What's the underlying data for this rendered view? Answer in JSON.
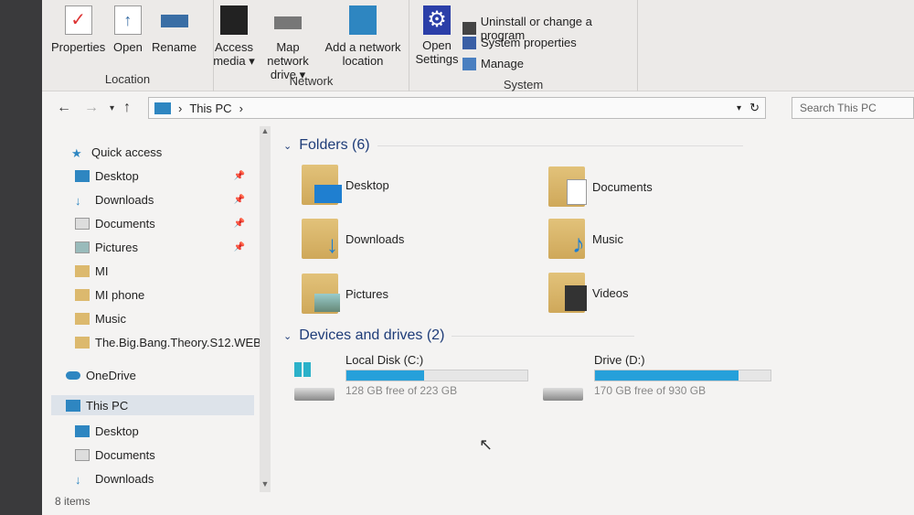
{
  "ribbon": {
    "location": {
      "label": "Location",
      "properties": "Properties",
      "open": "Open",
      "rename": "Rename"
    },
    "network": {
      "label": "Network",
      "access_media": "Access media ▾",
      "map_drive": "Map network drive ▾",
      "add_location": "Add a network location"
    },
    "system": {
      "label": "System",
      "open_settings": "Open Settings",
      "uninstall": "Uninstall or change a program",
      "system_properties": "System properties",
      "manage": "Manage"
    }
  },
  "address": {
    "path": "This PC",
    "search_placeholder": "Search This PC"
  },
  "sidebar": {
    "items": [
      {
        "label": "Quick access"
      },
      {
        "label": "Desktop"
      },
      {
        "label": "Downloads"
      },
      {
        "label": "Documents"
      },
      {
        "label": "Pictures"
      },
      {
        "label": "MI"
      },
      {
        "label": "MI phone"
      },
      {
        "label": "Music"
      },
      {
        "label": "The.Big.Bang.Theory.S12.WEB"
      },
      {
        "label": "OneDrive"
      },
      {
        "label": "This PC"
      },
      {
        "label": "Desktop"
      },
      {
        "label": "Documents"
      },
      {
        "label": "Downloads"
      }
    ]
  },
  "main": {
    "folders_header": "Folders (6)",
    "folders": [
      {
        "label": "Desktop"
      },
      {
        "label": "Documents"
      },
      {
        "label": "Downloads"
      },
      {
        "label": "Music"
      },
      {
        "label": "Pictures"
      },
      {
        "label": "Videos"
      }
    ],
    "drives_header": "Devices and drives (2)",
    "drives": [
      {
        "label": "Local Disk (C:)",
        "free": "128 GB free of 223 GB",
        "used_fraction": 0.43
      },
      {
        "label": "Drive (D:)",
        "free": "170 GB free of 930 GB",
        "used_fraction": 0.82
      }
    ]
  },
  "status": "8 items",
  "colors": {
    "accent": "#26a0da"
  }
}
